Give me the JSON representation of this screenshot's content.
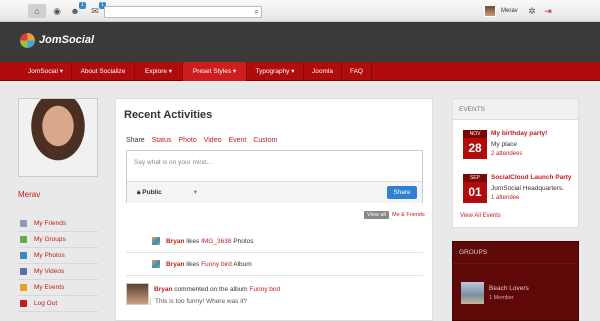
{
  "topbar": {
    "badge_friends": "1",
    "badge_msgs": "1",
    "username": "Merav"
  },
  "brand": {
    "name": "JomSocial"
  },
  "nav": [
    {
      "label": "JomSocial ▾"
    },
    {
      "label": "About Socialize"
    },
    {
      "label": "Explore ▾"
    },
    {
      "label": "Preset Styles ▾"
    },
    {
      "label": "Typography ▾"
    },
    {
      "label": "Joomla"
    },
    {
      "label": "FAQ"
    }
  ],
  "profile": {
    "name": "Merav"
  },
  "menu": [
    {
      "label": "My Friends",
      "color": "#8c9bb5"
    },
    {
      "label": "My Groups",
      "color": "#6aa84f"
    },
    {
      "label": "My Photos",
      "color": "#3a87c8"
    },
    {
      "label": "My Videos",
      "color": "#5b6fa8"
    },
    {
      "label": "My Events",
      "color": "#e8a22c"
    },
    {
      "label": "Log Out",
      "color": "#c31c1c"
    }
  ],
  "activity": {
    "title": "Recent Activities",
    "tabs": [
      "Share",
      "Status",
      "Photo",
      "Video",
      "Event",
      "Custom"
    ],
    "composer_placeholder": "Say what is on your mind...",
    "privacy": "Public",
    "share_button": "Share",
    "view_all": "View all",
    "my_friends": "Me & Friends",
    "items": [
      {
        "actor": "Bryan",
        "verb": "likes",
        "object": "IMG_3638",
        "suffix": "Photos"
      },
      {
        "actor": "Bryan",
        "verb": "likes",
        "object": "Funny bird",
        "suffix": "Album"
      }
    ],
    "comment": {
      "actor": "Bryan",
      "text": "commented on the album",
      "object": "Funny bird",
      "quote": "This is too funny! Where was it?"
    }
  },
  "events": {
    "title": "EVENTS",
    "items": [
      {
        "month": "NOV",
        "day": "28",
        "title": "My birthday party!",
        "place": "My place",
        "attendees": "2 attendees"
      },
      {
        "month": "SEP",
        "day": "01",
        "title": "SocialCloud Launch Party",
        "place": "JomSocial Headquarters.",
        "attendees": "1 attendee"
      }
    ],
    "view_all": "View All Events"
  },
  "groups": {
    "title": "GROUPS",
    "items": [
      {
        "name": "Beach Lovers",
        "members": "1 Member"
      }
    ]
  },
  "colors": {
    "brand_red": "#b10c0c",
    "accent_blue": "#2f7fd3",
    "header_dark": "#3a3a3a"
  }
}
